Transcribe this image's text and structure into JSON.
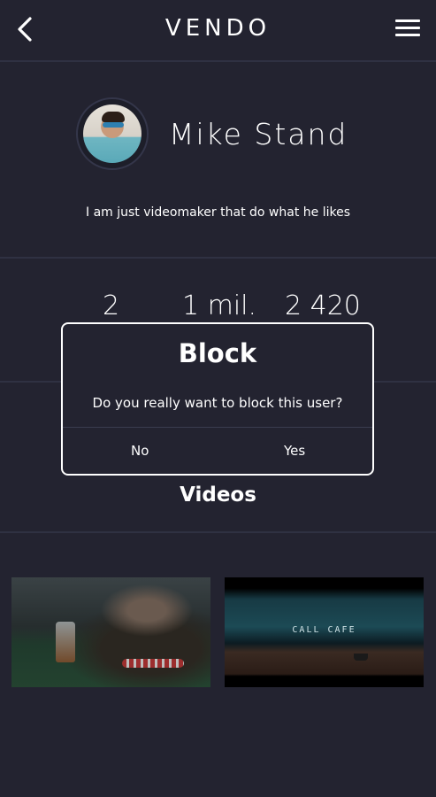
{
  "header": {
    "logo": "VENDO",
    "back_icon": "chevron-left-icon",
    "menu_icon": "hamburger-menu-icon"
  },
  "profile": {
    "name": "Mike Stand",
    "bio": "I am just videomaker that do what he likes"
  },
  "stats": {
    "values": [
      "2",
      "1 mil.",
      "2 420"
    ]
  },
  "videos": {
    "title": "Videos",
    "items": [
      {
        "thumbnail": "poker-scene"
      },
      {
        "thumbnail": "call-cafe-scene",
        "overlay_text": "CALL CAFE"
      }
    ]
  },
  "dialog": {
    "title": "Block",
    "message": "Do you really want to block this user?",
    "no_label": "No",
    "yes_label": "Yes"
  },
  "colors": {
    "background": "#232330",
    "divider": "#2f3142",
    "text": "#ffffff"
  }
}
